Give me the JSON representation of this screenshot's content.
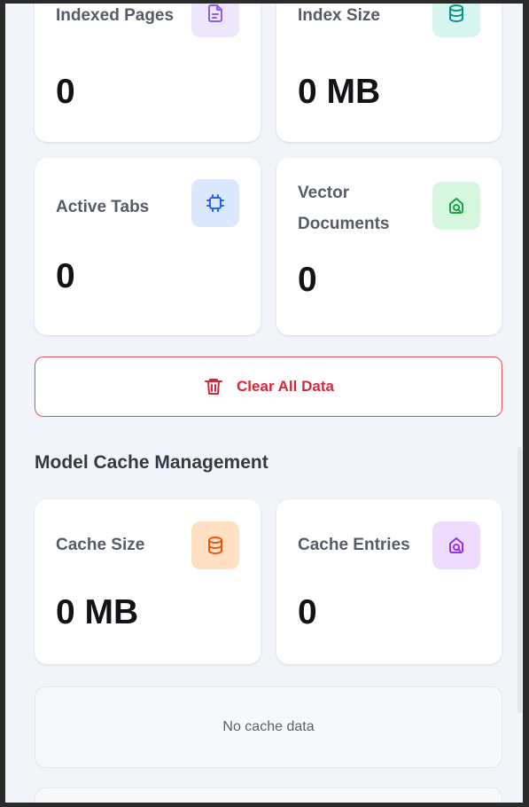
{
  "stats": [
    {
      "label": "Indexed Pages",
      "value": "0",
      "icon": "document-icon",
      "color": "#8b5cf6",
      "bg": "#ede6fd"
    },
    {
      "label": "Index Size",
      "value": "0 MB",
      "icon": "database-icon",
      "color": "#0d9488",
      "bg": "#d5f5ee"
    },
    {
      "label": "Active Tabs",
      "value": "0",
      "icon": "chip-icon",
      "color": "#2563eb",
      "bg": "#dbe7fd"
    },
    {
      "label": "Vector\nDocuments",
      "value": "0",
      "icon": "vector-icon",
      "color": "#16a34a",
      "bg": "#d6f6df"
    }
  ],
  "clear_button": {
    "label": "Clear All Data",
    "icon": "trash-icon",
    "color": "#d6283a"
  },
  "cache": {
    "title": "Model Cache Management",
    "stats": [
      {
        "label": "Cache Size",
        "value": "0 MB",
        "icon": "database-icon",
        "color": "#ea580c",
        "bg": "#ffe0c2"
      },
      {
        "label": "Cache Entries",
        "value": "0",
        "icon": "vector-icon",
        "color": "#9333ea",
        "bg": "#eddcfd"
      }
    ],
    "empty_text": "No cache data"
  }
}
